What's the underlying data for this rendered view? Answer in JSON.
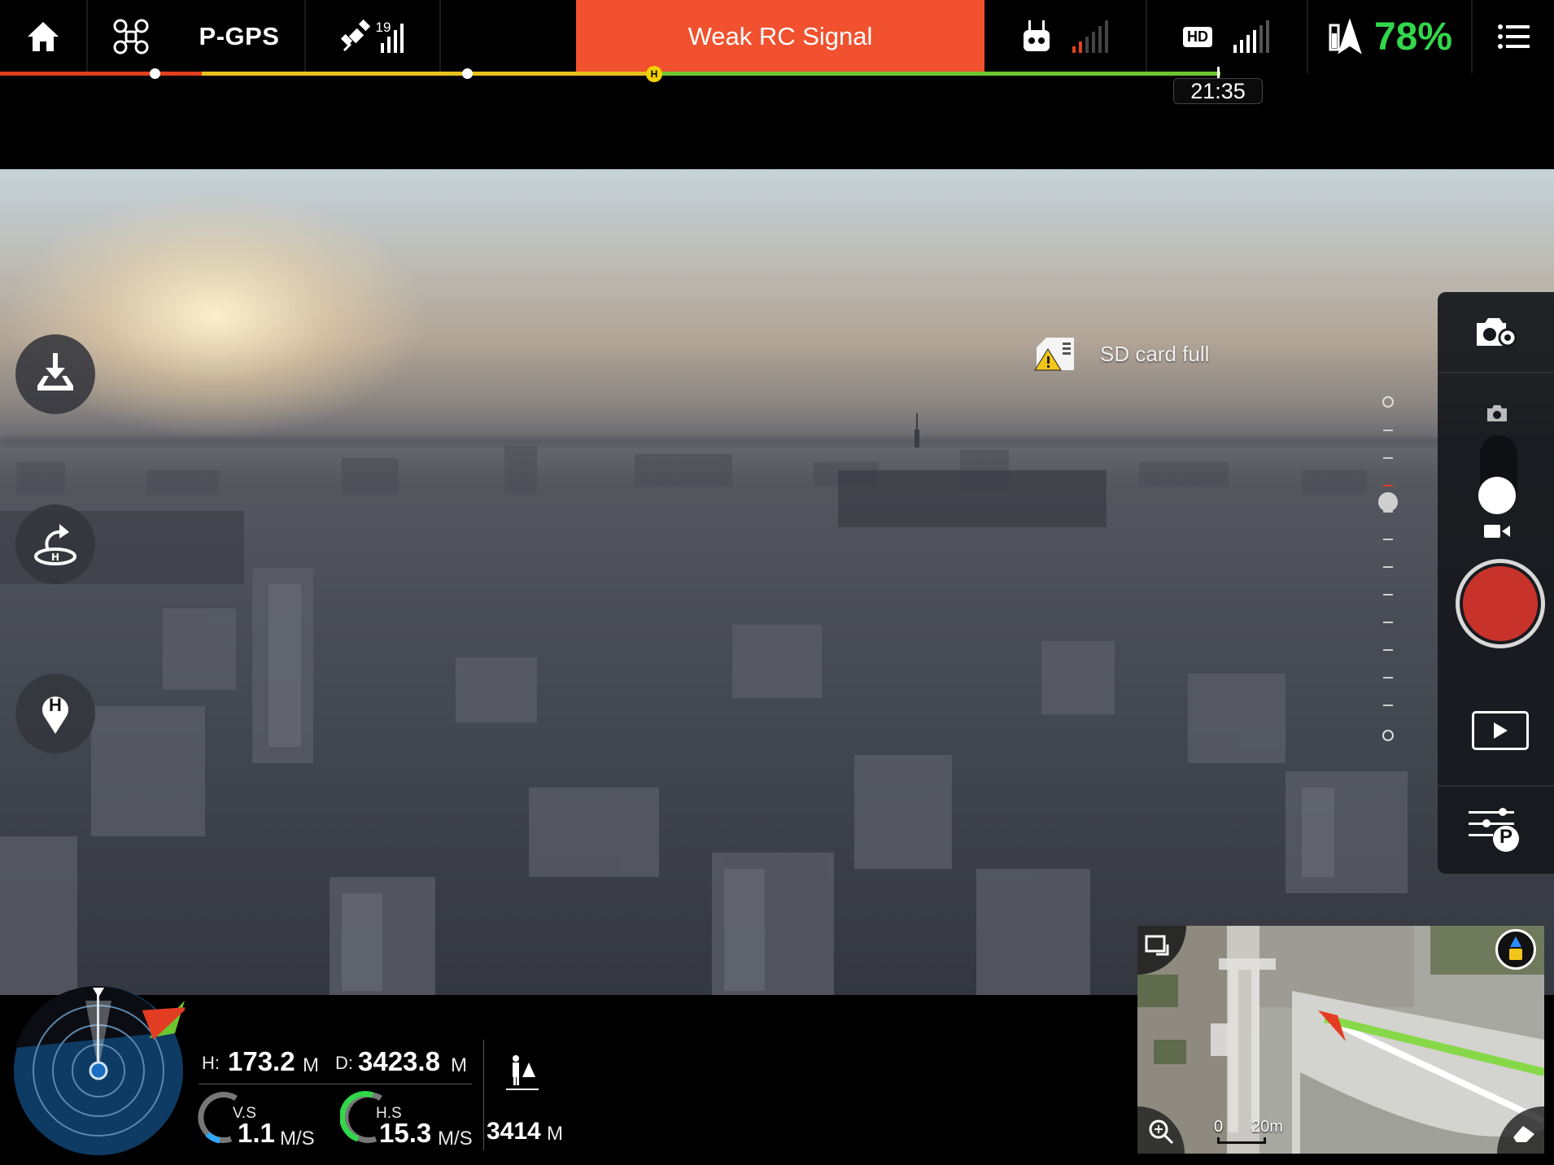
{
  "top_bar": {
    "flight_mode": "P-GPS",
    "satellite_count": "19",
    "alert": "Weak RC Signal",
    "hd_label": "HD",
    "battery_percent": "78%",
    "flight_time_remaining": "21:35",
    "home_marker_label": "H",
    "colors": {
      "alert_bg": "#f1512e",
      "battery": "#32d74b",
      "rc_signal": "#e0411e"
    }
  },
  "icons": {
    "home": "home-icon",
    "aircraft": "aircraft-icon",
    "satellite": "satellite-icon",
    "rc": "remote-controller-icon",
    "battery": "battery-icon",
    "menu": "menu-icon",
    "takeoff": "auto-takeoff-icon",
    "rth": "return-home-icon",
    "home_point": "home-point-icon",
    "camera_settings": "camera-settings-icon",
    "photo": "photo-icon",
    "video": "video-icon",
    "playback": "playback-icon",
    "params": "camera-params-icon"
  },
  "video": {
    "sd_warning": "SD card full"
  },
  "side_buttons": {
    "home_point_label": "H",
    "params_label": "P"
  },
  "telemetry": {
    "height_label": "H:",
    "height_value": "173.2",
    "height_unit": "M",
    "distance_label": "D:",
    "distance_value": "3423.8",
    "distance_unit": "M",
    "vs_label": "V.S",
    "vs_value": "1.1",
    "vs_unit": "M/S",
    "hs_label": "H.S",
    "hs_value": "15.3",
    "hs_unit": "M/S",
    "pilot_distance_value": "3414",
    "pilot_distance_unit": "M"
  },
  "minimap": {
    "scale_zero": "0",
    "scale_label": "20m"
  }
}
